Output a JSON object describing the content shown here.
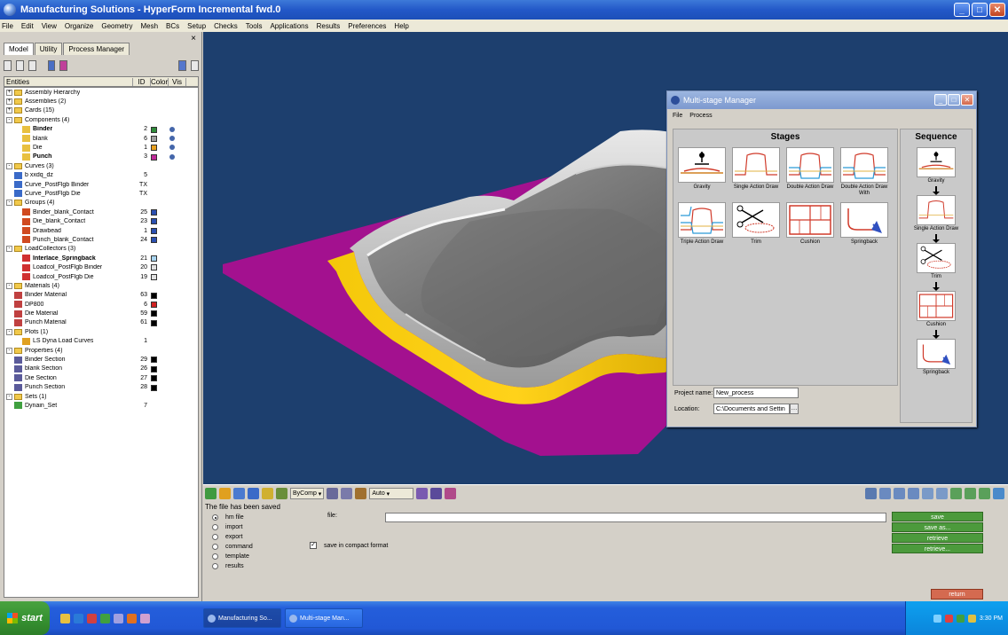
{
  "window": {
    "title": "Manufacturing Solutions - HyperForm Incremental fwd.0"
  },
  "menu": [
    "File",
    "Edit",
    "View",
    "Organize",
    "Geometry",
    "Mesh",
    "BCs",
    "Setup",
    "Checks",
    "Tools",
    "Applications",
    "Results",
    "Preferences",
    "Help"
  ],
  "left_panel": {
    "tabs": [
      "Model",
      "Utility",
      "Process Manager"
    ],
    "columns": [
      "Entities",
      "ID",
      "Color",
      "Vis"
    ],
    "tree": [
      {
        "level": 0,
        "label": "Assembly Hierarchy",
        "type": "folder",
        "exp": "+"
      },
      {
        "level": 0,
        "label": "Assemblies (2)",
        "type": "folder",
        "exp": "+"
      },
      {
        "level": 0,
        "label": "Cards (15)",
        "type": "folder",
        "exp": "+"
      },
      {
        "level": 0,
        "label": "Components (4)",
        "type": "folder",
        "exp": "-"
      },
      {
        "level": 2,
        "label": "Binder",
        "type": "comp",
        "bold": true,
        "id": "2",
        "color": "#2e8b3a",
        "ball": true
      },
      {
        "level": 2,
        "label": "blank",
        "type": "comp",
        "id": "6",
        "color": "#a0a0a0",
        "ball": true
      },
      {
        "level": 2,
        "label": "Die",
        "type": "comp",
        "id": "1",
        "color": "#e8a020",
        "ball": true
      },
      {
        "level": 2,
        "label": "Punch",
        "type": "comp",
        "bold": true,
        "id": "3",
        "color": "#c02a9a",
        "ball": true
      },
      {
        "level": 0,
        "label": "Curves (3)",
        "type": "folder",
        "exp": "-"
      },
      {
        "level": 1,
        "label": "b                    xxdq_dz",
        "type": "curve",
        "id": "5"
      },
      {
        "level": 1,
        "label": "Curve_PostFlgb Binder",
        "type": "curve",
        "id": "TX"
      },
      {
        "level": 1,
        "label": "Curve_PostFlgb Die",
        "type": "curve",
        "id": "TX"
      },
      {
        "level": 0,
        "label": "Groups (4)",
        "type": "folder",
        "exp": "-"
      },
      {
        "level": 2,
        "label": "Binder_blank_Contact",
        "type": "group",
        "id": "25",
        "color": "#2a4fb0"
      },
      {
        "level": 2,
        "label": "Die_blank_Contact",
        "type": "group",
        "id": "23",
        "color": "#2a4fb0"
      },
      {
        "level": 2,
        "label": "Drawbead",
        "type": "group",
        "id": "1",
        "color": "#2a4fb0"
      },
      {
        "level": 2,
        "label": "Punch_blank_Contact",
        "type": "group",
        "id": "24",
        "color": "#2a4fb0"
      },
      {
        "level": 0,
        "label": "LoadCollectors (3)",
        "type": "folder",
        "exp": "-"
      },
      {
        "level": 2,
        "label": "Interlace_Springback",
        "type": "load",
        "bold": true,
        "id": "21",
        "color": "#a8d4f0"
      },
      {
        "level": 2,
        "label": "Loadcol_PostFlgb Binder",
        "type": "load",
        "id": "20",
        "color": "#e0e0e0"
      },
      {
        "level": 2,
        "label": "Loadcol_PostFlgb Die",
        "type": "load",
        "id": "19",
        "color": "#e0e0e0"
      },
      {
        "level": 0,
        "label": "Materials (4)",
        "type": "folder",
        "exp": "-"
      },
      {
        "level": 1,
        "label": "Binder Material",
        "type": "mat",
        "id": "63",
        "color": "#000000"
      },
      {
        "level": 1,
        "label": "DP800",
        "type": "mat",
        "id": "6",
        "color": "#d02020"
      },
      {
        "level": 1,
        "label": "Die Material",
        "type": "mat",
        "id": "59",
        "color": "#000000"
      },
      {
        "level": 1,
        "label": "Punch Material",
        "type": "mat",
        "id": "61",
        "color": "#000000"
      },
      {
        "level": 0,
        "label": "Plots (1)",
        "type": "folder",
        "exp": "-"
      },
      {
        "level": 2,
        "label": "LS Dyna Load Curves",
        "type": "plot",
        "id": "1"
      },
      {
        "level": 0,
        "label": "Properties (4)",
        "type": "folder",
        "exp": "-"
      },
      {
        "level": 1,
        "label": "Binder Section",
        "type": "prop",
        "id": "29",
        "color": "#000000"
      },
      {
        "level": 1,
        "label": "blank Section",
        "type": "prop",
        "id": "26",
        "color": "#000000"
      },
      {
        "level": 1,
        "label": "Die Section",
        "type": "prop",
        "id": "27",
        "color": "#000000"
      },
      {
        "level": 1,
        "label": "Punch Section",
        "type": "prop",
        "id": "28",
        "color": "#000000"
      },
      {
        "level": 0,
        "label": "Sets (1)",
        "type": "folder",
        "exp": "-"
      },
      {
        "level": 1,
        "label": "Dynain_Set",
        "type": "set",
        "id": "7"
      }
    ]
  },
  "dialog": {
    "title": "Multi-stage Manager",
    "menu": [
      "File",
      "Process"
    ],
    "stages_title": "Stages",
    "sequence_title": "Sequence",
    "stages": [
      {
        "label": "Gravity",
        "icon": "gravity"
      },
      {
        "label": "Single Action Draw",
        "icon": "single"
      },
      {
        "label": "Double Action Draw",
        "icon": "double"
      },
      {
        "label": "Double Action Draw With",
        "icon": "doublewith"
      },
      {
        "label": "Triple Action Draw",
        "icon": "triple"
      },
      {
        "label": "Trim",
        "icon": "trim"
      },
      {
        "label": "Cushion",
        "icon": "cushion"
      },
      {
        "label": "Springback",
        "icon": "springback"
      }
    ],
    "sequence": [
      {
        "label": "Gravity",
        "icon": "gravity"
      },
      {
        "label": "Single Action Draw",
        "icon": "single"
      },
      {
        "label": "Trim",
        "icon": "trim"
      },
      {
        "label": "Cushion",
        "icon": "cushion"
      },
      {
        "label": "Springback",
        "icon": "springback"
      }
    ],
    "project_name_label": "Project name:",
    "project_name_value": "New_process",
    "location_label": "Location:",
    "location_value": "C:\\Documents and Settin"
  },
  "bottom_toolbar": {
    "select1": "ByComp",
    "select2": "Auto"
  },
  "command_panel": {
    "status": "The file has been saved",
    "options": [
      "hm file",
      "import",
      "export",
      "command",
      "template",
      "results"
    ],
    "selected_option": 0,
    "file_label": "file:",
    "file_value": "",
    "checkbox_label": "save in compact format",
    "checkbox_checked": true,
    "buttons": [
      "save",
      "save as...",
      "retrieve",
      "retrieve..."
    ],
    "return_label": "return"
  },
  "taskbar": {
    "start_label": "start",
    "tasks": [
      "Manufacturing So...",
      "Multi-stage Man..."
    ],
    "clock": "3:30 PM"
  },
  "colors": {
    "viewport_bg": "#1d3f6e",
    "blank_magenta": "#a3118f",
    "die_yellow": "#f0c000",
    "button_green": "#4c9a3c",
    "return_red": "#d46a50"
  }
}
